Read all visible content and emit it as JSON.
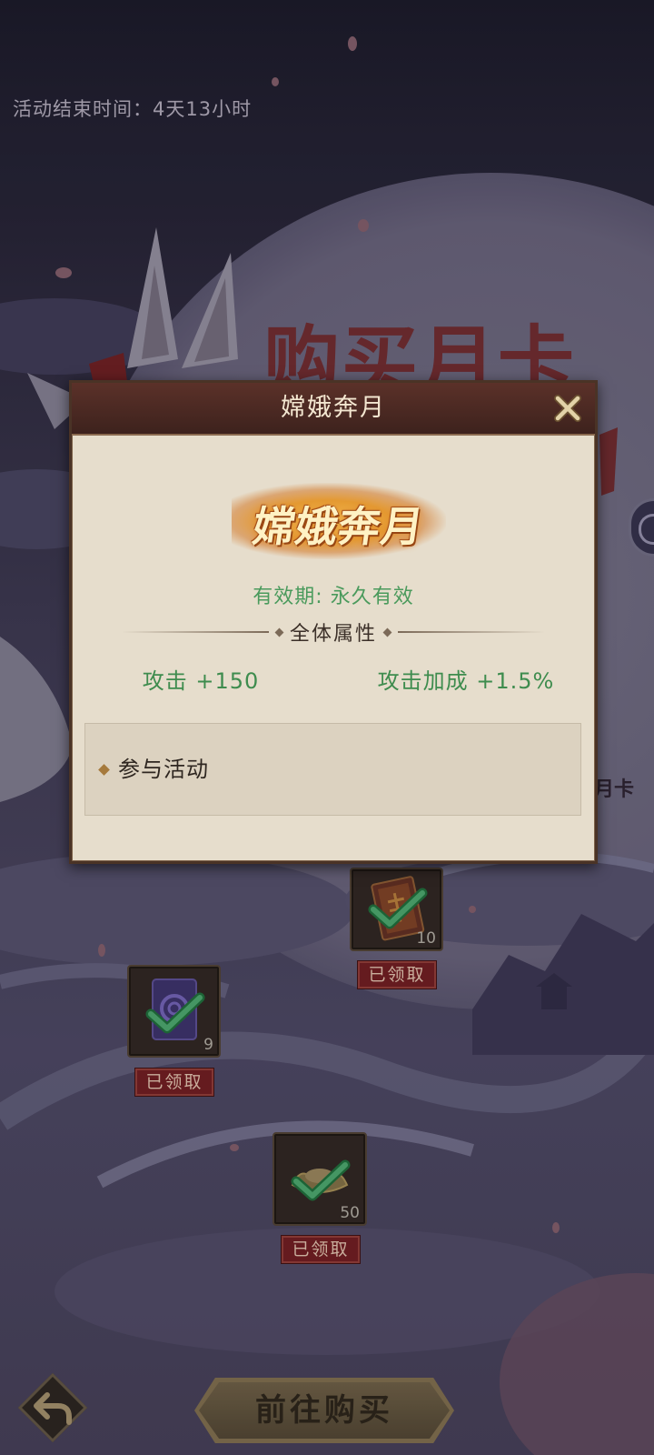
{
  "screen": {
    "activity_timer": "活动结束时间：4天13小时"
  },
  "background": {
    "title": "购买月卡",
    "side_label": "月卡"
  },
  "modal": {
    "title": "嫦娥奔月",
    "logo_text": "嫦娥奔月",
    "validity": "有效期: 永久有效",
    "section_title": "全体属性",
    "stats": [
      "攻击 +150",
      "攻击加成 +1.5%"
    ],
    "source_label": "参与活动",
    "close_icon": "close-icon"
  },
  "rewards": [
    {
      "icon": "scroll-icon",
      "count": "10",
      "status": "已领取",
      "claimed": true
    },
    {
      "icon": "purple-book-icon",
      "count": "9",
      "status": "已领取",
      "claimed": true
    },
    {
      "icon": "gold-ingot-icon",
      "count": "50",
      "status": "已领取",
      "claimed": true
    }
  ],
  "footer": {
    "buy_button": "前往购买",
    "back_icon": "back-arrow-icon"
  },
  "colors": {
    "stat_green": "#3e8c4e",
    "validity_green": "#4a9a5c",
    "modal_body": "#e6ddcc",
    "modal_header": "#4e2a24",
    "claimed_badge": "#6c1d21",
    "checkmark": "#4aa06a",
    "background_title": "#6c2b2f"
  }
}
